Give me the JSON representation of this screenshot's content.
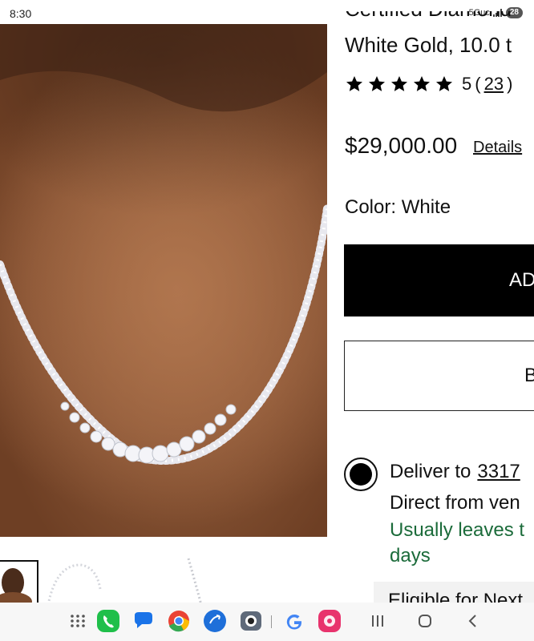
{
  "status_bar": {
    "time": "8:30",
    "network": "5Guc",
    "battery": "28"
  },
  "product": {
    "title_line_partial": "Certified Diamond",
    "title_line2": "White Gold, 10.0 t",
    "rating_value": "5",
    "review_count": "23",
    "price": "$29,000.00",
    "details_label": "Details",
    "color_label": "Color: White"
  },
  "buttons": {
    "add_label": "AD",
    "second_label": "B"
  },
  "delivery": {
    "deliver_label": "Deliver to",
    "address": "3317",
    "direct_line": "Direct from ven",
    "leaves_line1": "Usually leaves t",
    "leaves_line2": "days",
    "eligible_text": "Eligible for Next"
  },
  "colors": {
    "accent_green": "#1b6b3a",
    "button_black": "#000000"
  },
  "nav_bar": {
    "apps": [
      "apps-grid-icon",
      "phone-icon",
      "messages-icon",
      "chrome-icon",
      "share-icon",
      "camera-icon",
      "google-icon",
      "gallery-icon"
    ],
    "system": [
      "recents-icon",
      "home-icon",
      "back-icon"
    ]
  }
}
